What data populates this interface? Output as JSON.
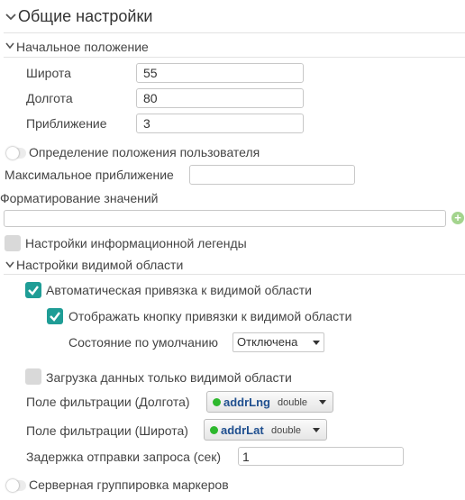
{
  "page_title": "Общие настройки",
  "initial_position": {
    "title": "Начальное положение",
    "latitude_label": "Широта",
    "latitude_value": "55",
    "longitude_label": "Долгота",
    "longitude_value": "80",
    "zoom_label": "Приближение",
    "zoom_value": "3"
  },
  "geolocation": {
    "label": "Определение положения пользователя",
    "enabled": false
  },
  "max_zoom": {
    "label": "Максимальное приближение",
    "value": ""
  },
  "value_formatting": {
    "label": "Форматирование значений",
    "value": ""
  },
  "legend_settings": {
    "label": "Настройки информационной легенды",
    "checked": false
  },
  "viewport_settings": {
    "title": "Настройки видимой области",
    "auto_bind_label": "Автоматическая привязка к видимой области",
    "auto_bind_checked": true,
    "show_bind_button_label": "Отображать кнопку привязки к видимой области",
    "show_bind_button_checked": true,
    "default_state_label": "Состояние по умолчанию",
    "default_state_value": "Отключена",
    "viewport_only_label": "Загрузка данных только видимой области",
    "viewport_only_checked": false,
    "filter_lng_label": "Поле фильтрации (Долгота)",
    "filter_lng_field": "addrLng",
    "filter_lng_type": "double",
    "filter_lat_label": "Поле фильтрации (Широта)",
    "filter_lat_field": "addrLat",
    "filter_lat_type": "double",
    "request_delay_label": "Задержка отправки запроса (сек)",
    "request_delay_value": "1"
  },
  "server_clustering": {
    "label": "Серверная группировка маркеров",
    "enabled": false
  },
  "colors": {
    "accent": "#1f9d96",
    "field_dot": "#2db82d",
    "field_name": "#1f4f8f",
    "add_button": "#a4d48e"
  },
  "icons": [
    "chevron-down-icon",
    "check-icon",
    "plus-icon",
    "dropdown-arrow-icon"
  ]
}
